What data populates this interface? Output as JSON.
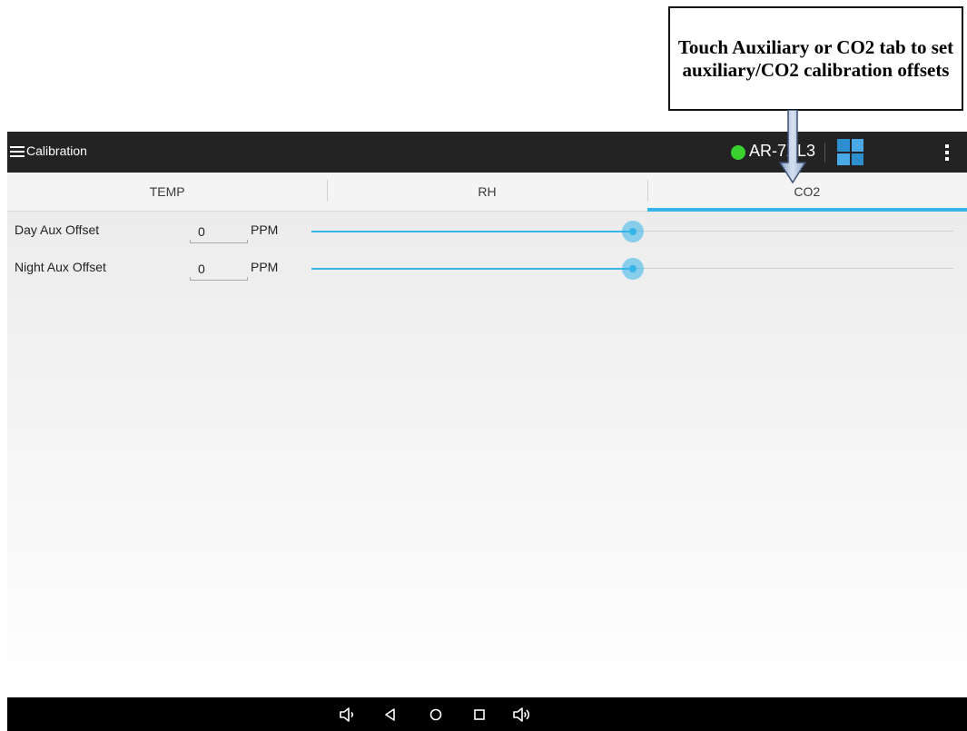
{
  "annotation": {
    "text": "Touch Auxiliary or CO2 tab to set auxiliary/CO2 calibration offsets"
  },
  "appbar": {
    "title": "Calibration",
    "device": "AR-7XL3",
    "status_color": "#3ad12f",
    "icons": [
      "menu-icon",
      "grid-icon",
      "overflow-menu-icon"
    ]
  },
  "tabs": [
    {
      "label": "TEMP",
      "active": false
    },
    {
      "label": "RH",
      "active": false
    },
    {
      "label": "CO2",
      "active": true
    }
  ],
  "offsets": [
    {
      "label": "Day Aux Offset",
      "value": "0",
      "unit": "PPM",
      "slider_fraction": 0.5
    },
    {
      "label": "Night Aux Offset",
      "value": "0",
      "unit": "PPM",
      "slider_fraction": 0.5
    }
  ],
  "navbar": {
    "icons": [
      "volume-down-icon",
      "back-icon",
      "home-icon",
      "recents-icon",
      "volume-up-icon"
    ]
  },
  "colors": {
    "accent": "#35b5ea",
    "appbar": "#232323",
    "status_online": "#3ad12f"
  }
}
